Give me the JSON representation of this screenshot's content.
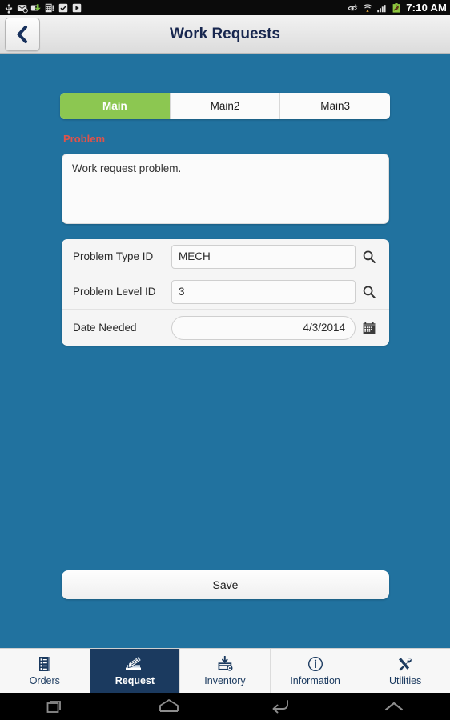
{
  "statusbar": {
    "time": "7:10 AM",
    "left_icons": [
      "usb-icon",
      "email-icon",
      "download-arrow-icon",
      "calculator-icon",
      "checkbox-icon",
      "play-store-icon"
    ],
    "right_icons": [
      "eye-icon",
      "wifi-icon",
      "signal-bars-icon",
      "battery-icon"
    ]
  },
  "titlebar": {
    "title": "Work Requests",
    "back_icon": "chevron-left-icon"
  },
  "tabs": [
    {
      "label": "Main",
      "active": true
    },
    {
      "label": "Main2",
      "active": false
    },
    {
      "label": "Main3",
      "active": false
    }
  ],
  "problem": {
    "label": "Problem",
    "label_color": "#e0534a",
    "text": "Work request problem."
  },
  "fields": [
    {
      "label": "Problem Type ID",
      "value": "MECH",
      "action_icon": "search-icon",
      "pill": false
    },
    {
      "label": "Problem Level ID",
      "value": "3",
      "action_icon": "search-icon",
      "pill": false
    },
    {
      "label": "Date Needed",
      "value": "4/3/2014",
      "action_icon": "calendar-icon",
      "pill": true
    }
  ],
  "save": {
    "label": "Save"
  },
  "appnav": [
    {
      "label": "Orders",
      "icon": "list-document-icon",
      "active": false
    },
    {
      "label": "Request",
      "icon": "write-request-icon",
      "active": true
    },
    {
      "label": "Inventory",
      "icon": "box-download-icon",
      "active": false
    },
    {
      "label": "Information",
      "icon": "info-circle-icon",
      "active": false
    },
    {
      "label": "Utilities",
      "icon": "tools-icon",
      "active": false
    }
  ],
  "sysnav": [
    {
      "icon": "recents-icon"
    },
    {
      "icon": "home-icon"
    },
    {
      "icon": "back-icon"
    },
    {
      "icon": "expand-up-icon"
    }
  ],
  "colors": {
    "background": "#21729f",
    "tab_active": "#8cc751",
    "nav_active": "#1b3a5f",
    "title_text": "#18274f"
  }
}
